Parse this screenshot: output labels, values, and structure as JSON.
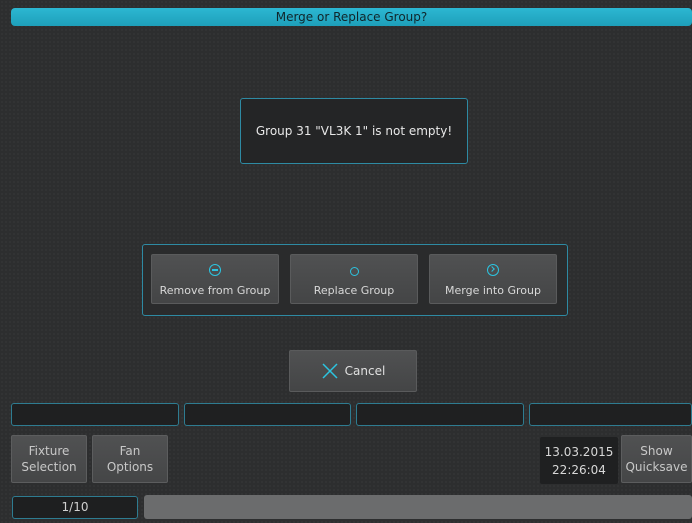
{
  "dialog": {
    "title": "Merge or Replace Group?",
    "message": "Group 31 \"VL3K 1\" is not empty!",
    "actions": [
      {
        "label": "Remove from Group",
        "icon": "remove-icon"
      },
      {
        "label": "Replace Group",
        "icon": "replace-icon"
      },
      {
        "label": "Merge into Group",
        "icon": "merge-icon"
      }
    ],
    "cancel_label": "Cancel"
  },
  "softkeys": {
    "fixture_selection": [
      "Fixture",
      "Selection"
    ],
    "fan_options": [
      "Fan",
      "Options"
    ],
    "show_quicksave": [
      "Show",
      "Quicksave"
    ]
  },
  "clock": {
    "date": "13.03.2015",
    "time": "22:26:04"
  },
  "page": "1/10",
  "colors": {
    "accent": "#2cb7d2",
    "background": "#2d2e2f"
  }
}
